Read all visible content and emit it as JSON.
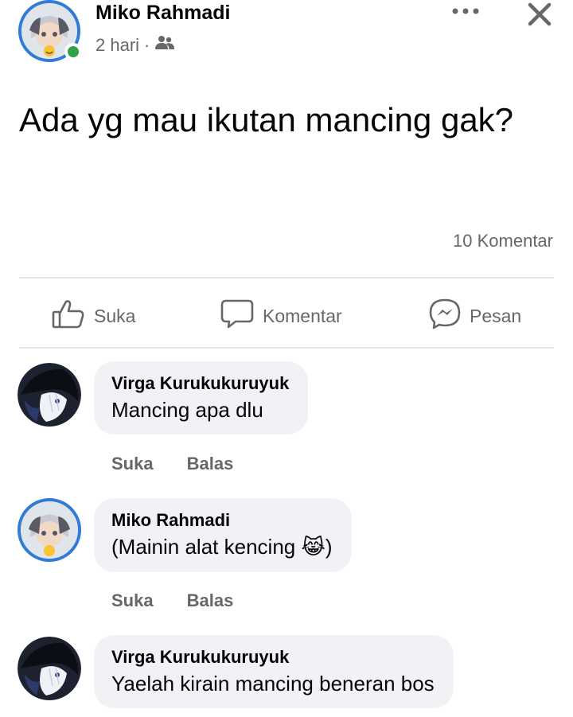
{
  "post": {
    "author": "Miko Rahmadi",
    "time": "2 hari",
    "separator": "·",
    "audience_icon": "friends-icon",
    "text": "Ada yg mau ikutan mancing gak?",
    "comment_count": "10 Komentar"
  },
  "actions": {
    "like_label": "Suka",
    "comment_label": "Komentar",
    "message_label": "Pesan"
  },
  "comments": [
    {
      "name": "Virga Kurukukuruyuk",
      "text": "Mancing apa dlu",
      "like": "Suka",
      "reply": "Balas"
    },
    {
      "name": "Miko Rahmadi",
      "text": "(Mainin alat kencing ",
      "text_end": ")",
      "emoji": "😹",
      "like": "Suka",
      "reply": "Balas"
    },
    {
      "name": "Virga Kurukukuruyuk",
      "text": "Yaelah kirain mancing beneran bos"
    }
  ],
  "colors": {
    "accent_ring": "#2f7bd6",
    "online": "#31a24c",
    "bubble": "#f0f2f5",
    "secondary_text": "#65676b"
  }
}
